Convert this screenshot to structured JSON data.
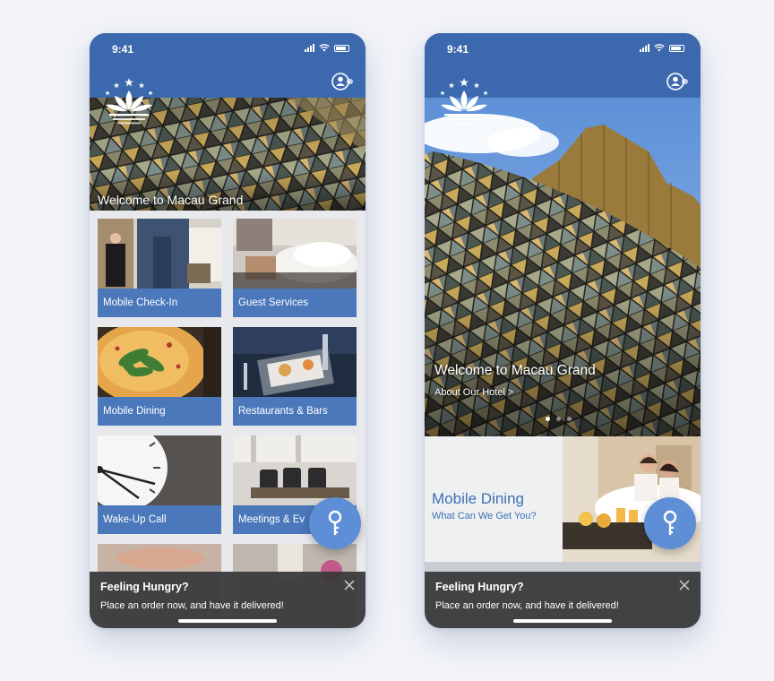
{
  "colors": {
    "brand_blue": "#3c69ad",
    "tile_label_blue": "#4a78bb",
    "fab_blue": "#5e8ed6",
    "promo_text_blue": "#3f6fb5",
    "toast_bg": "#3a3a3c",
    "page_bg": "#f2f4f9"
  },
  "screen_home_grid": {
    "status_time": "9:41",
    "hero_title": "Welcome to Macau Grand",
    "tiles": [
      {
        "label": "Mobile Check-In",
        "icon": "tile-photo-checkin"
      },
      {
        "label": "Guest Services",
        "icon": "tile-photo-guest-services"
      },
      {
        "label": "Mobile Dining",
        "icon": "tile-photo-dining"
      },
      {
        "label": "Restaurants & Bars",
        "icon": "tile-photo-restaurants"
      },
      {
        "label": "Wake-Up Call",
        "icon": "tile-photo-clock"
      },
      {
        "label": "Meetings & Ev",
        "icon": "tile-photo-meetings"
      }
    ],
    "toast": {
      "title": "Feeling Hungry?",
      "body": "Place an order now, and have it delivered!"
    },
    "fab_icon": "key-icon",
    "profile_icon": "profile-toggle-icon"
  },
  "screen_home_hero": {
    "status_time": "9:41",
    "hero_title": "Welcome to Macau Grand",
    "hero_link": "About Our Hotel  >",
    "carousel_dots": 3,
    "carousel_active_index": 0,
    "promo": {
      "title": "Mobile Dining",
      "subtitle": "What Can We Get You?"
    },
    "toast": {
      "title": "Feeling Hungry?",
      "body": "Place an order now, and have it delivered!"
    },
    "fab_icon": "key-icon",
    "profile_icon": "profile-toggle-icon"
  }
}
